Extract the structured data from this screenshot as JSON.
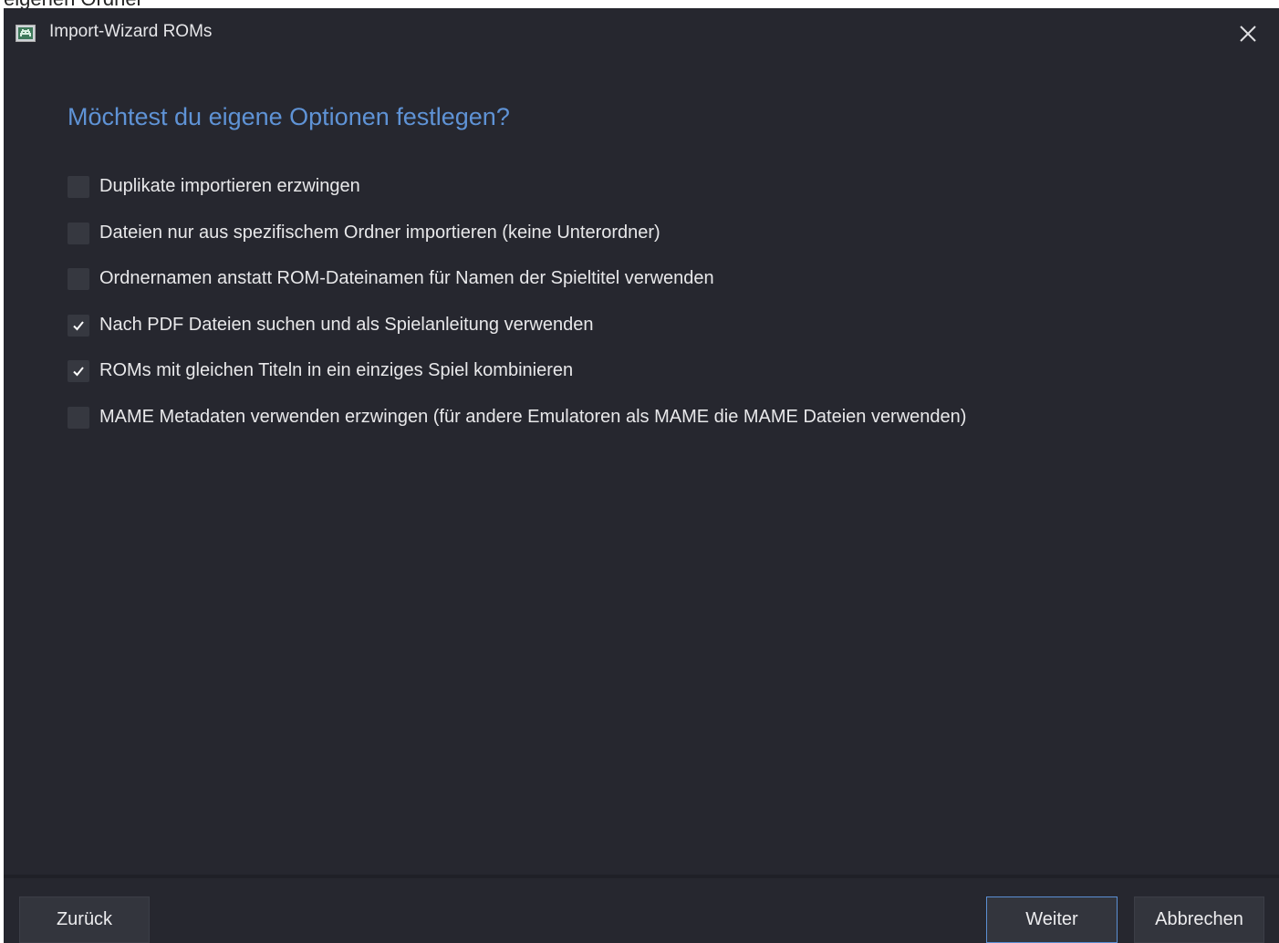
{
  "background_window": {
    "partial_text": "eigenen Ordner"
  },
  "window": {
    "title": "Import-Wizard ROMs",
    "icon": "space-invader-icon",
    "close_icon": "close-icon"
  },
  "page": {
    "heading": "Möchtest du eigene Optionen festlegen?",
    "options": [
      {
        "label": "Duplikate importieren erzwingen",
        "checked": false
      },
      {
        "label": "Dateien nur aus spezifischem Ordner importieren (keine Unterordner)",
        "checked": false
      },
      {
        "label": "Ordnernamen anstatt ROM-Dateinamen für Namen der Spieltitel verwenden",
        "checked": false
      },
      {
        "label": "Nach PDF Dateien suchen und als Spielanleitung verwenden",
        "checked": true
      },
      {
        "label": "ROMs mit gleichen Titeln in ein einziges Spiel kombinieren",
        "checked": true
      },
      {
        "label": "MAME Metadaten verwenden erzwingen (für andere Emulatoren als MAME die MAME Dateien verwenden)",
        "checked": false
      }
    ]
  },
  "footer": {
    "back_label": "Zurück",
    "next_label": "Weiter",
    "cancel_label": "Abbrechen"
  },
  "colors": {
    "window_bg": "#26272f",
    "accent": "#5f93d6",
    "checkbox_bg": "#363840",
    "button_bg": "#33353d"
  }
}
